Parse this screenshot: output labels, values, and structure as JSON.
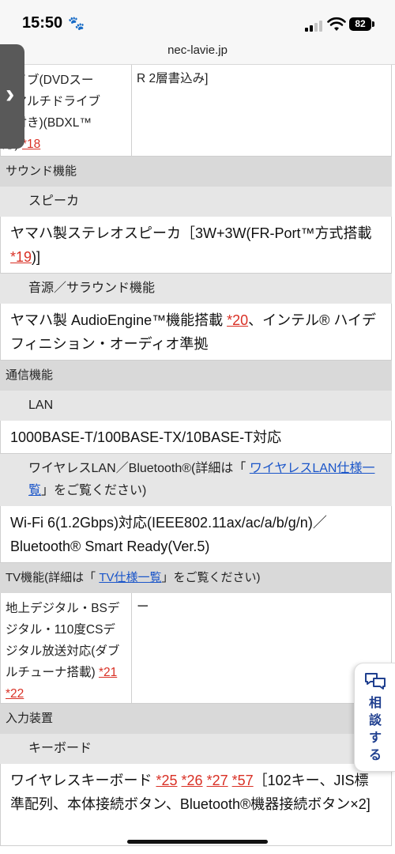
{
  "status_bar": {
    "time": "15:50",
    "paw_icon": "🐾",
    "battery": "82"
  },
  "browser": {
    "url": "nec-lavie.jp"
  },
  "top_fragment": {
    "left_lines": [
      "ライブ(DVDスー",
      "ーマルチドライブ",
      "能付き)(BDXL™",
      "応)"
    ],
    "left_ref": "*18",
    "right_text": "R 2層書込み]"
  },
  "sound": {
    "section_label": "サウンド機能",
    "speaker": {
      "label": "スピーカ",
      "value_pre": "ヤマハ製ステレオスピーカ［3W+3W(FR-Port™方式搭載 ",
      "ref": "*19",
      "value_post": ")]"
    },
    "audio": {
      "label": "音源／サラウンド機能",
      "value_pre": "ヤマハ製 AudioEngine™機能搭載 ",
      "ref": "*20",
      "value_post": "、インテル® ハイデフィニション・オーディオ準拠"
    }
  },
  "communication": {
    "section_label": "通信機能",
    "lan": {
      "label": "LAN",
      "value": "1000BASE-T/100BASE-TX/10BASE-T対応"
    },
    "wireless": {
      "label_pre": "ワイヤレスLAN／Bluetooth®(詳細は「 ",
      "link": "ワイヤレスLAN仕様一覧",
      "label_post": "」をご覧ください)",
      "value": "Wi-Fi 6(1.2Gbps)対応(IEEE802.11ax/ac/a/b/g/n)／Bluetooth® Smart Ready(Ver.5)"
    }
  },
  "tv": {
    "section_pre": "TV機能(詳細は「 ",
    "section_link": "TV仕様一覧",
    "section_post": "」をご覧ください)",
    "row_left": "地上デジタル・BSデジタル・110度CSデジタル放送対応(ダブルチューナ搭載) ",
    "row_refs": [
      "*21",
      "*22"
    ],
    "row_right": "ー"
  },
  "input": {
    "section_label": "入力装置",
    "keyboard": {
      "label": "キーボード",
      "value_pre": "ワイヤレスキーボード ",
      "refs": [
        "*25",
        "*26",
        "*27",
        "*57"
      ],
      "value_post": "［102キー、JIS標準配列、本体接続ボタン、Bluetooth®機器接続ボタン×2]"
    }
  },
  "overlays": {
    "side_tab_icon": "›",
    "consult_label": "相談する",
    "consult_icon": "chat-bubbles-icon"
  },
  "colors": {
    "section_bg": "#d9d9d9",
    "subsection_bg": "#e6e6e6",
    "ref_red": "#d93025",
    "link_blue": "#1a55c9",
    "consult_navy": "#1f3f8f"
  }
}
